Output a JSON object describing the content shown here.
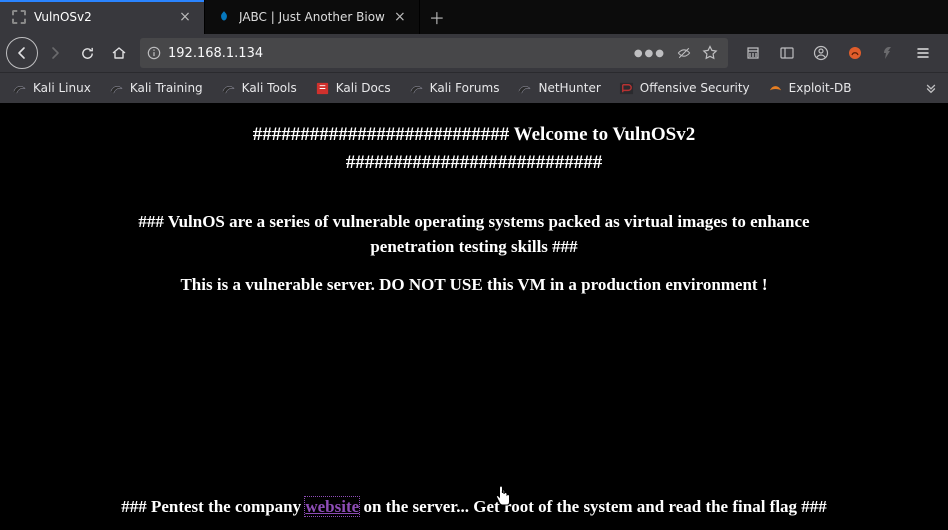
{
  "tabs": [
    {
      "title": "VulnOSv2",
      "active": true,
      "favicon": "vuln"
    },
    {
      "title": "JABC | Just Another Biow",
      "active": false,
      "favicon": "drupal"
    }
  ],
  "url": "192.168.1.134",
  "bookmarks": [
    {
      "label": "Kali Linux",
      "icon": "dragon"
    },
    {
      "label": "Kali Training",
      "icon": "dragon"
    },
    {
      "label": "Kali Tools",
      "icon": "dragon"
    },
    {
      "label": "Kali Docs",
      "icon": "red"
    },
    {
      "label": "Kali Forums",
      "icon": "dragon"
    },
    {
      "label": "NetHunter",
      "icon": "dragon"
    },
    {
      "label": "Offensive Security",
      "icon": "offsec"
    },
    {
      "label": "Exploit-DB",
      "icon": "exploit"
    }
  ],
  "page": {
    "heading_l1": "########################### Welcome to VulnOSv2",
    "heading_l2": "###########################",
    "para1_l1": "### VulnOS are a series of vulnerable operating systems packed as virtual images to enhance",
    "para1_l2": "penetration testing skills ###",
    "para2": "This is a vulnerable server. DO NOT USE this VM in a production environment !",
    "bottom_pre": "### Pentest the company ",
    "bottom_link": "website",
    "bottom_post": " on the server... Get root of the system and read the final flag ###"
  }
}
